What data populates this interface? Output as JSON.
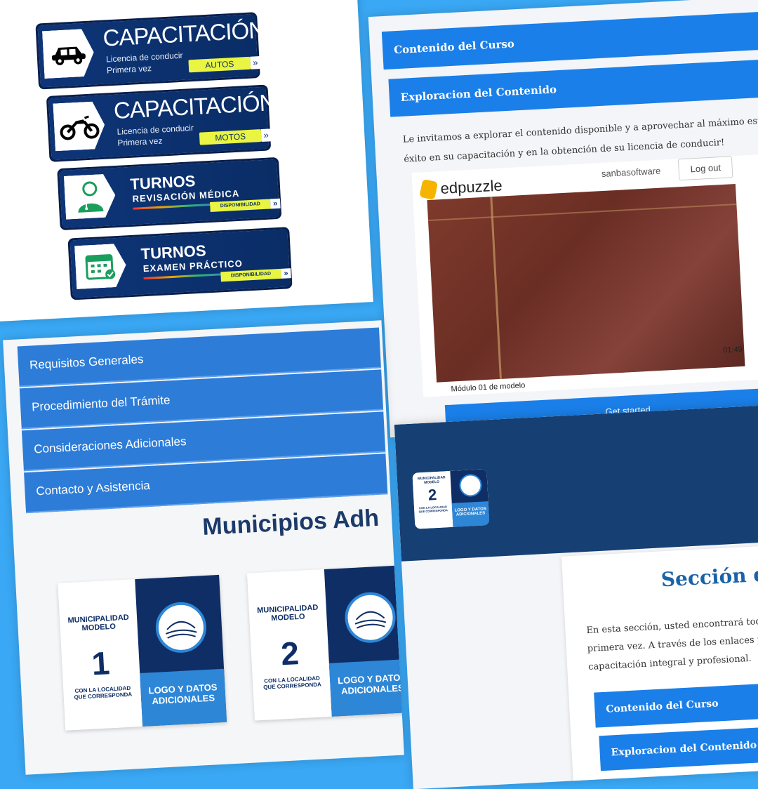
{
  "banners": {
    "capacitacion_autos": {
      "title": "CAPACITACIÓN",
      "line1": "Licencia de conducir",
      "line2": "Primera vez",
      "tag": "AUTOS"
    },
    "capacitacion_motos": {
      "title": "CAPACITACIÓN",
      "line1": "Licencia de conducir",
      "line2": "Primera vez",
      "tag": "MOTOS"
    },
    "turnos_medica": {
      "title": "TURNOS",
      "subtitle": "REVISACIÓN MÉDICA",
      "tag": "DISPONIBILIDAD"
    },
    "turnos_practico": {
      "title": "TURNOS",
      "subtitle": "EXAMEN PRÁCTICO",
      "tag": "DISPONIBILIDAD"
    }
  },
  "course": {
    "bar_contenido": "Contenido del Curso",
    "bar_exploracion": "Exploracion del Contenido",
    "para_line1": "Le invitamos a explorar el contenido disponible y a aprovechar al máximo esta he",
    "para_line2": "éxito en su capacitación y en la obtención de su licencia de conducir!",
    "user": "sanbasoftware",
    "logout": "Log out",
    "brand": "edpuzzle",
    "video_time": "01:49",
    "video_caption": "Módulo 01 de modelo",
    "get_started": "Get started"
  },
  "accordion": {
    "items": [
      "Requisitos Generales",
      "Procedimiento del Trámite",
      "Consideraciones Adicionales",
      "Contacto y Asistencia"
    ],
    "municipios_title": "Municipios Adh"
  },
  "cards": [
    {
      "mm": "MUNICIPALIDAD MODELO",
      "num": "1",
      "loc": "CON LA LOCALIDAD QUE CORRESPONDA",
      "logo": "LOGO Y DATOS ADICIONALES"
    },
    {
      "mm": "MUNICIPALIDAD MODELO",
      "num": "2",
      "loc": "CON LA LOCALIDAD QUE CORRESPONDA",
      "logo": "LOGO Y DATOS ADICIONALES"
    }
  ],
  "section": {
    "logo_num": "2",
    "logo_mm": "MUNICIPALIDAD MODELO",
    "logo_loc": "CON LA LOCALIDAD QUE CORRESPONDA",
    "logo_text": "LOGO Y DATOS ADICIONALES",
    "title": "Sección de",
    "para_line1": "En esta sección, usted encontrará todos los",
    "para_line2": "primera vez. A través de los enlaces propo",
    "para_line3": "capacitación integral y profesional.",
    "bar_contenido": "Contenido del Curso",
    "bar_exploracion": "Exploracion del Contenido"
  },
  "colors": {
    "background": "#3aa8f5",
    "navy": "#0e3578",
    "accent_blue": "#1a7fe8",
    "tag_yellow": "#e9f542"
  }
}
